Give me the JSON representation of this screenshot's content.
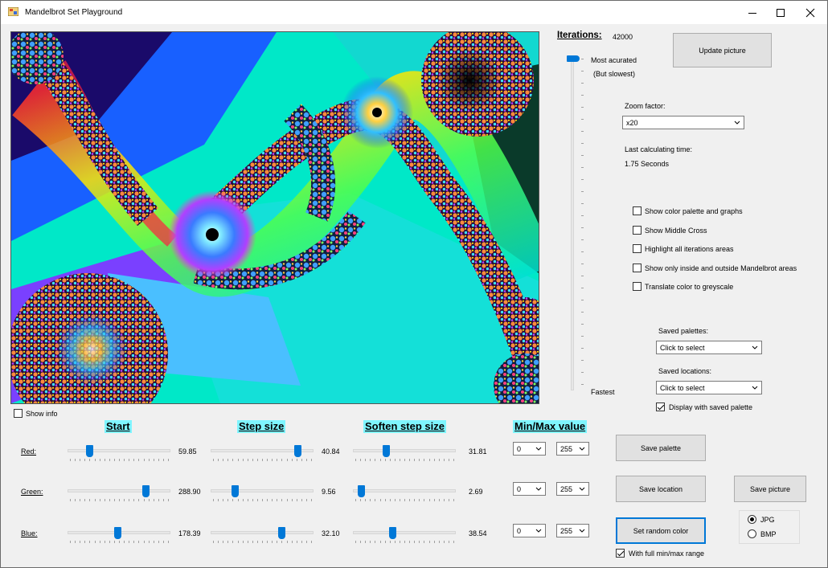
{
  "window": {
    "title": "Mandelbrot Set Playground"
  },
  "iterations": {
    "label": "Iterations:",
    "value": "42000",
    "top_label": "Most acurated",
    "top_sublabel": "(But slowest)",
    "bottom_label": "Fastest",
    "slider_level": 1.0
  },
  "update_button": "Update picture",
  "zoom": {
    "label": "Zoom factor:",
    "selected": "x20"
  },
  "calc_time": {
    "label": "Last calculating time:",
    "value": "1.75 Seconds"
  },
  "options": [
    {
      "label": "Show color palette and graphs",
      "checked": false
    },
    {
      "label": "Show Middle Cross",
      "checked": false
    },
    {
      "label": "Highlight all iterations areas",
      "checked": false
    },
    {
      "label": "Show only inside and outside Mandelbrot areas",
      "checked": false
    },
    {
      "label": "Translate color to greyscale",
      "checked": false
    }
  ],
  "saved_palettes": {
    "label": "Saved palettes:",
    "selected": "Click to select"
  },
  "saved_locations": {
    "label": "Saved locations:",
    "selected": "Click to select"
  },
  "display_with_palette": {
    "label": "Display with saved palette",
    "checked": true
  },
  "show_info": {
    "label": "Show info",
    "checked": false
  },
  "headings": {
    "start": "Start",
    "step": "Step size",
    "soften": "Soften step size",
    "minmax": "Min/Max value"
  },
  "color_rows": [
    {
      "label": "Red:",
      "start": "59.85",
      "start_pos": 0.19,
      "step": "40.84",
      "step_pos": 0.87,
      "soften": "31.81",
      "soften_pos": 0.31,
      "min": "0",
      "max": "255"
    },
    {
      "label": "Green:",
      "start": "288.90",
      "start_pos": 0.78,
      "step": "9.56",
      "step_pos": 0.22,
      "soften": "2.69",
      "soften_pos": 0.05,
      "min": "0",
      "max": "255"
    },
    {
      "label": "Blue:",
      "start": "178.39",
      "start_pos": 0.49,
      "step": "32.10",
      "step_pos": 0.71,
      "soften": "38.54",
      "soften_pos": 0.38,
      "min": "0",
      "max": "255"
    }
  ],
  "buttons": {
    "save_palette": "Save  palette",
    "save_location": "Save location",
    "save_picture": "Save picture",
    "random_color": "Set random color"
  },
  "format": {
    "jpg": "JPG",
    "bmp": "BMP",
    "selected": "JPG"
  },
  "full_range": {
    "label": "With full min/max range",
    "checked": true
  },
  "colors": {
    "accent": "#0078d7",
    "heading_bg": "#7ff5ff",
    "window_bg": "#f0f0f0"
  }
}
